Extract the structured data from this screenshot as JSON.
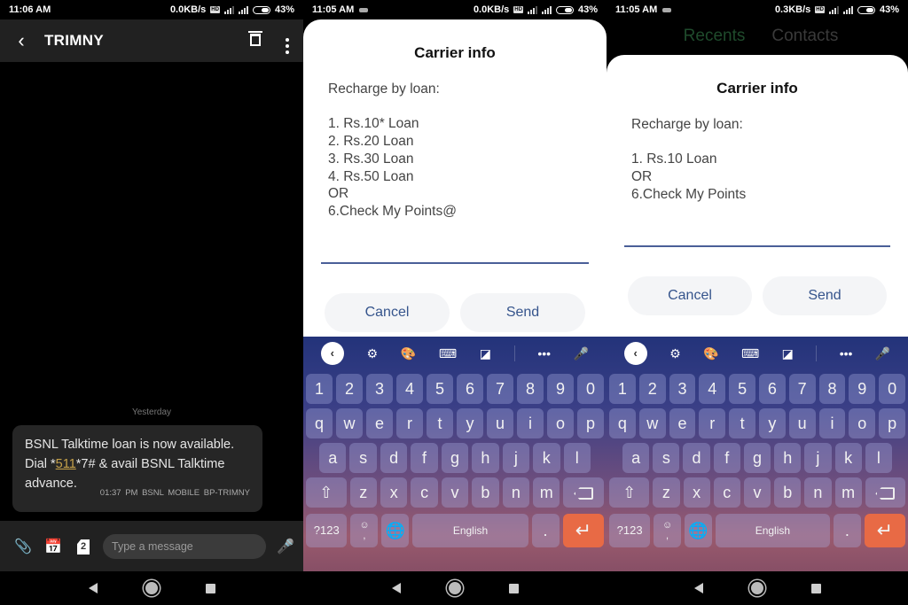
{
  "panels": [
    {
      "status": {
        "time": "11:06 AM",
        "speed": "0.0KB/s",
        "battery": "43%"
      },
      "appbar": {
        "title": "TRIMNY",
        "back_icon": "‹"
      },
      "conversation": {
        "day_header": "Yesterday",
        "message": {
          "line1": "BSNL Talktime loan is now available.",
          "line2_pre": "Dial *",
          "code": "511",
          "line2_post": "*7# & avail BSNL Talktime",
          "line3": "advance.",
          "meta": "01:37 PM  BSNL MOBILE  BP-TRIMNY"
        }
      },
      "composer": {
        "placeholder": "Type a message",
        "sim_number": "2",
        "attach_icon": "📎",
        "mic_icon": "🎤",
        "schedule_icon": "📅"
      }
    },
    {
      "status": {
        "time": "11:05 AM",
        "speed": "0.0KB/s",
        "battery": "43%"
      },
      "dialog": {
        "title": "Carrier info",
        "body": "Recharge by loan:\n\n1. Rs.10* Loan\n2. Rs.20 Loan\n3. Rs.30 Loan\n4. Rs.50 Loan\nOR\n6.Check My Points@",
        "cancel": "Cancel",
        "send": "Send"
      }
    },
    {
      "status": {
        "time": "11:05 AM",
        "speed": "0.3KB/s",
        "battery": "43%"
      },
      "tabs": [
        "Recents",
        "Contacts"
      ],
      "dialog": {
        "title": "Carrier info",
        "body": "Recharge by loan:\n\n1. Rs.10 Loan\nOR\n6.Check My Points",
        "cancel": "Cancel",
        "send": "Send"
      }
    }
  ],
  "keyboard": {
    "toolbar": {
      "collapse": "‹",
      "settings": "⚙",
      "theme": "🎨",
      "layout": "⌨",
      "resize": "◪",
      "more": "•••",
      "mic": "🎤"
    },
    "numbers": [
      "1",
      "2",
      "3",
      "4",
      "5",
      "6",
      "7",
      "8",
      "9",
      "0"
    ],
    "row_q": [
      "q",
      "w",
      "e",
      "r",
      "t",
      "y",
      "u",
      "i",
      "o",
      "p"
    ],
    "row_a": [
      "a",
      "s",
      "d",
      "f",
      "g",
      "h",
      "j",
      "k",
      "l"
    ],
    "row_z": [
      "z",
      "x",
      "c",
      "v",
      "b",
      "n",
      "m"
    ],
    "shift": "⇧",
    "symbols": "?123",
    "emoji_top": "☺",
    "emoji_bottom": ",",
    "globe": "🌐",
    "space": "English",
    "period": ".",
    "enter": "↵"
  },
  "colors": {
    "accent_button_text": "#35548c",
    "enter_key": "#e86a45",
    "code_link": "#c7a24a"
  }
}
